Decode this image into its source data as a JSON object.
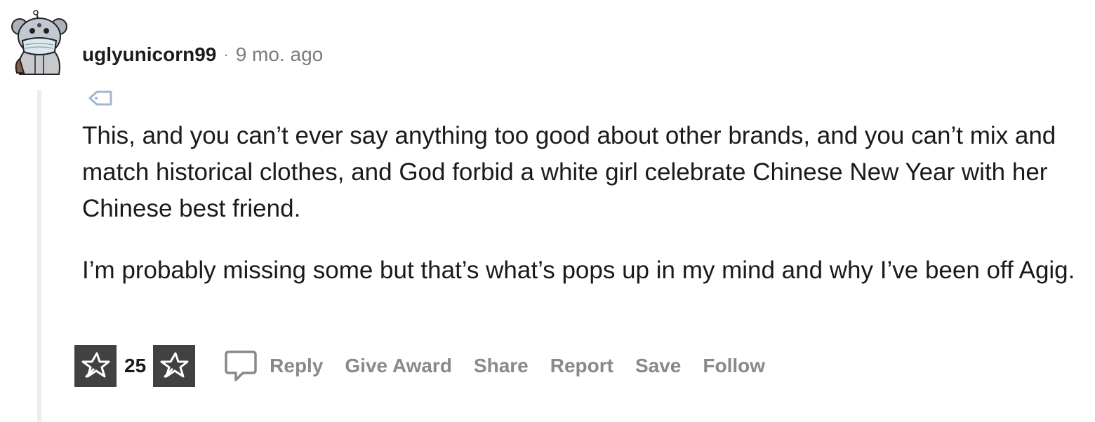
{
  "comment": {
    "author": "uglyunicorn99",
    "separator": "·",
    "time": "9 mo. ago",
    "paragraphs": [
      "This, and you can’t ever say anything too good about other brands, and you can’t mix and match historical clothes, and God forbid a white girl celebrate Chinese New Year with her Chinese best friend.",
      "I’m probably missing some but that’s what’s pops up in my mind and why I’ve been off Agig."
    ],
    "score": "25"
  },
  "actions": {
    "reply": "Reply",
    "give_award": "Give Award",
    "share": "Share",
    "report": "Report",
    "save": "Save",
    "follow": "Follow"
  },
  "icons": {
    "avatar": "snoo-avatar-mask",
    "flair": "tag-icon",
    "upvote": "upvote-icon",
    "downvote": "downvote-icon",
    "reply": "speech-bubble-icon"
  },
  "colors": {
    "vote_button_bg": "#414141",
    "action_text": "#878a8c",
    "thread_line": "#ededed",
    "flair_icon": "#a3b6d0"
  }
}
